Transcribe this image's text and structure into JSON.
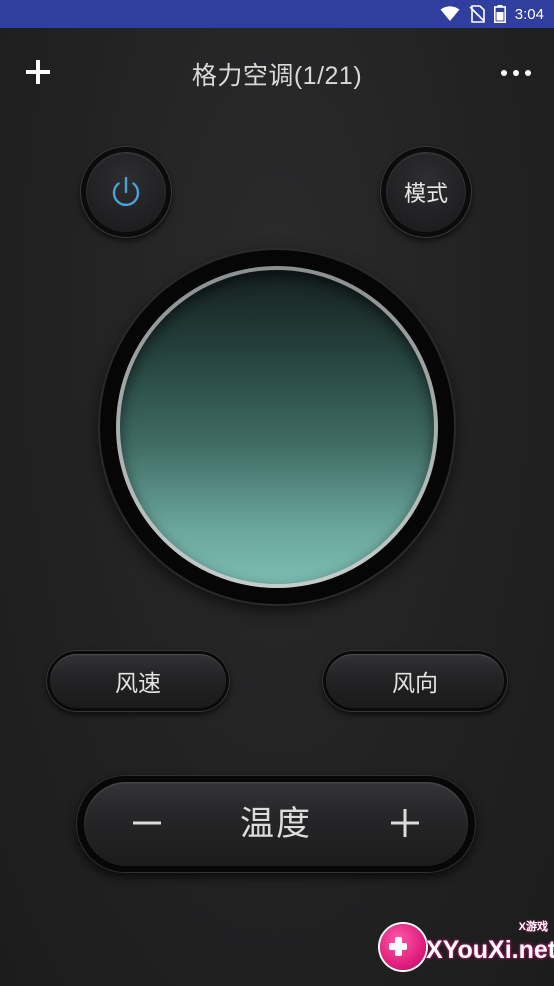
{
  "status_bar": {
    "time": "3:04",
    "icons": [
      "wifi-icon",
      "no-sim-icon",
      "battery-icon"
    ]
  },
  "header": {
    "title": "格力空调(1/21)",
    "add_icon": "plus-icon",
    "more_icon": "more-dots-icon"
  },
  "controls": {
    "power_icon": "power-icon",
    "mode_label": "模式",
    "wind_speed_label": "风速",
    "wind_direction_label": "风向",
    "temperature_label": "温度",
    "temp_minus": "−",
    "temp_plus": "+"
  },
  "watermark": {
    "text": "XYouXi.net",
    "small_text": "X游戏"
  },
  "colors": {
    "status_bar": "#303f9f",
    "power_icon": "#4aa3d8",
    "dial_top": "#162120",
    "dial_bottom": "#7cbdb2"
  }
}
